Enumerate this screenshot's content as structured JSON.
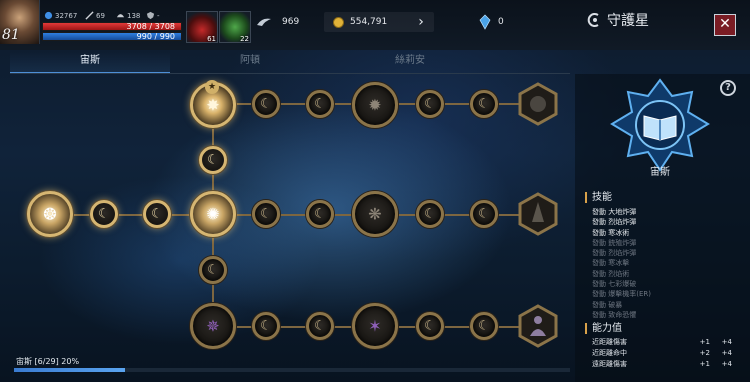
{
  "player": {
    "level": "81",
    "stat_power": "32767",
    "stat_attack": "69",
    "stat_defense": "138",
    "stat_misc": "-",
    "hp_text": "3708 / 3708",
    "hp_fraction": 1.0,
    "mp_text": "990 / 990",
    "mp_fraction": 1.0
  },
  "items": [
    {
      "name": "potion-icon",
      "count": "61"
    },
    {
      "name": "herb-icon",
      "count": "22"
    }
  ],
  "currencies": {
    "wings": "969",
    "gold": "554,791",
    "crystal": "0"
  },
  "title": "守護星",
  "tabs": [
    {
      "label": "宙斯",
      "active": true
    },
    {
      "label": "阿頓",
      "active": false
    },
    {
      "label": "絲莉安",
      "active": false
    }
  ],
  "constellation": {
    "name": "宙斯",
    "progress_text": "宙斯 [6/29] 20%",
    "progress_fraction": 0.2
  },
  "skills_title": "技能",
  "skills": [
    {
      "label": "發動 大地炸彈",
      "active": true
    },
    {
      "label": "發動 烈焰炸彈",
      "active": true
    },
    {
      "label": "發動 寒冰術",
      "active": true
    },
    {
      "label": "發動 銃殖炸彈",
      "active": false
    },
    {
      "label": "發動 烈焰炸彈",
      "active": false
    },
    {
      "label": "發動 寒冰擊",
      "active": false
    },
    {
      "label": "發動 烈焰術",
      "active": false
    },
    {
      "label": "發動 七彩爆破",
      "active": false
    },
    {
      "label": "發動 爆擊機率(ER)",
      "active": false
    },
    {
      "label": "發動 破暴",
      "active": false
    },
    {
      "label": "發動 致命恐懼",
      "active": false
    }
  ],
  "abilities_title": "能力值",
  "abilities": [
    {
      "label": "近距離傷害",
      "a": "+1",
      "b": "+4"
    },
    {
      "label": "近距離命中",
      "a": "+2",
      "b": "+4"
    },
    {
      "label": "遠距離傷害",
      "a": "+1",
      "b": "+4"
    }
  ],
  "colors": {
    "accent": "#4d8fd6",
    "node_border": "#8b7449",
    "hp": "#e23a3a",
    "mp": "#2f7fe0"
  }
}
